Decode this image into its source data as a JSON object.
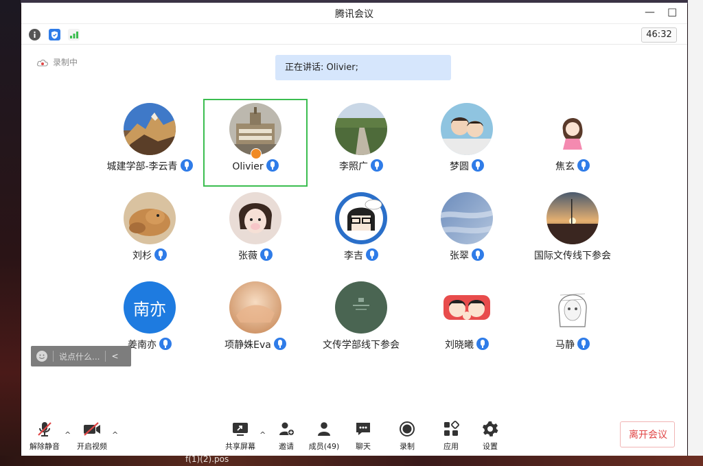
{
  "window": {
    "title": "腾讯会议",
    "minimize": "—",
    "maximize": "□"
  },
  "toolbar": {
    "timer": "46:32"
  },
  "recording": {
    "label": "录制中"
  },
  "speaking": {
    "label": "正在讲话: Olivier;"
  },
  "participants": [
    {
      "name": "城建学部-李云青",
      "avatar": "mountain-photo",
      "mic": true
    },
    {
      "name": "Olivier",
      "avatar": "building-photo",
      "mic": true,
      "active": true,
      "host": true
    },
    {
      "name": "李照广",
      "avatar": "road-photo",
      "mic": true
    },
    {
      "name": "梦圆",
      "avatar": "couple-photo",
      "mic": true
    },
    {
      "name": "焦玄",
      "avatar": "cartoon-girl",
      "mic": true
    },
    {
      "name": "刘杉",
      "avatar": "dog-photo",
      "mic": true
    },
    {
      "name": "张薇",
      "avatar": "child-photo",
      "mic": true
    },
    {
      "name": "李吉",
      "avatar": "cartoon-glasses",
      "mic": true
    },
    {
      "name": "张翠",
      "avatar": "sky-photo",
      "mic": true
    },
    {
      "name": "国际文传线下参会",
      "avatar": "sunset-photo",
      "mic": false
    },
    {
      "name": "姜南亦",
      "avatar": "text-avatar",
      "avatar_text": "南亦",
      "mic": true
    },
    {
      "name": "项静姝Eva",
      "avatar": "warm-photo",
      "mic": true
    },
    {
      "name": "文传学部线下参会",
      "avatar": "green-logo",
      "mic": false
    },
    {
      "name": "刘晓曦",
      "avatar": "cartoon-couple",
      "mic": true
    },
    {
      "name": "马静",
      "avatar": "sketch-girl",
      "mic": true
    }
  ],
  "chat": {
    "placeholder": "说点什么...",
    "collapse": "<"
  },
  "bottombar": {
    "unmute": "解除静音",
    "start_video": "开启视频",
    "share": "共享屏幕",
    "invite": "邀请",
    "members": "成员(49)",
    "chat": "聊天",
    "record": "录制",
    "apps": "应用",
    "settings": "设置",
    "leave": "离开会议"
  },
  "taskbar": {
    "label": "f(1)(2).pos"
  },
  "colors": {
    "mic": "#2f7ce8",
    "active_border": "#3bbd4f",
    "leave": "#e04545",
    "speaking_bg": "#d6e6fc"
  }
}
